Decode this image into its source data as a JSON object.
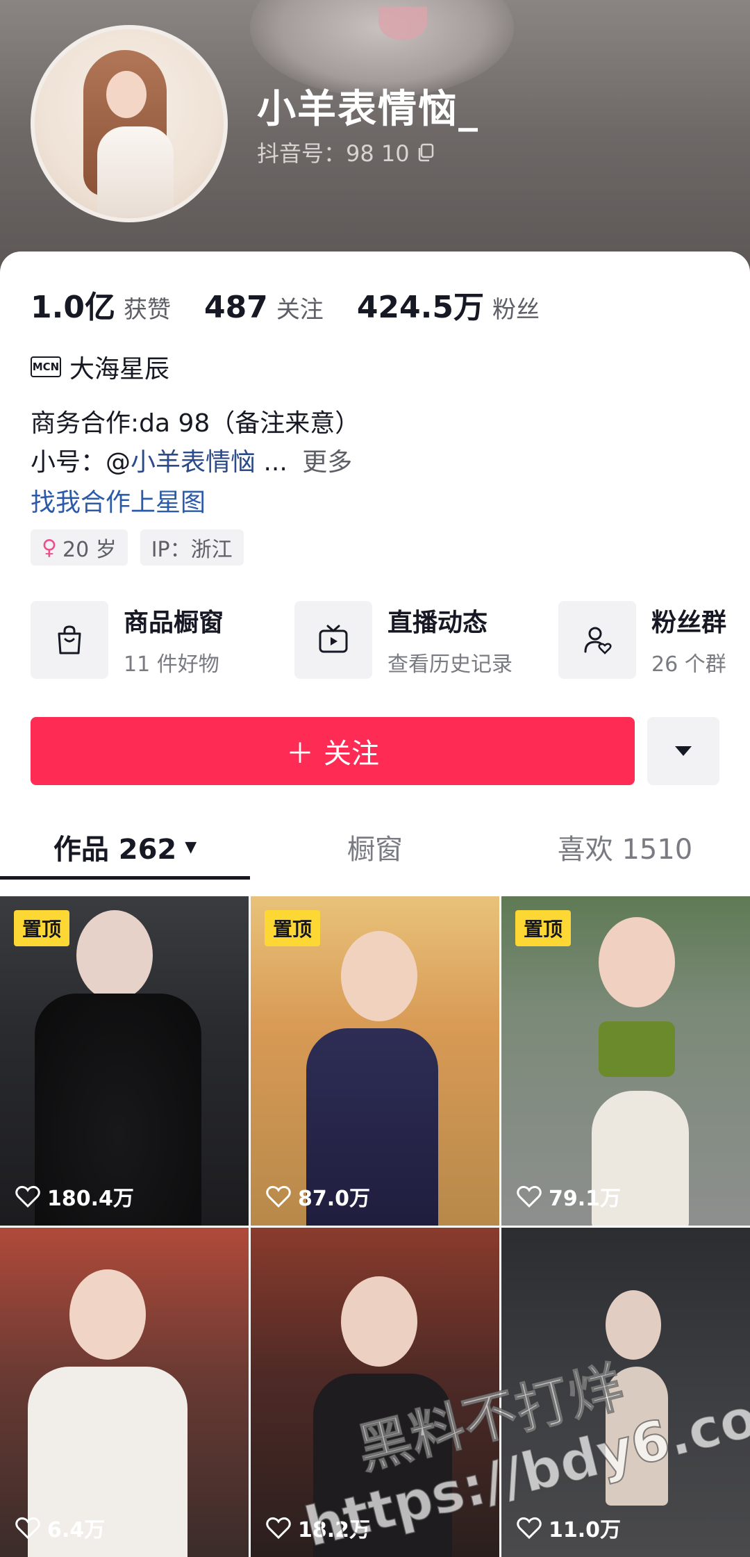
{
  "profile": {
    "username": "小羊表情恼_",
    "douyin_id": "抖音号：98   10"
  },
  "stats": [
    {
      "value": "1.0亿",
      "label": "获赞"
    },
    {
      "value": "487",
      "label": "关注"
    },
    {
      "value": "424.5万",
      "label": "粉丝"
    }
  ],
  "mcn": {
    "badge": "MCN",
    "name": "大海星辰"
  },
  "bio": {
    "line1": "商务合作:da            98（备注来意）",
    "line2_prefix": "小号：@",
    "line2_handle": "小羊表情恼",
    "line2_ellipsis": "...",
    "line2_more": "更多",
    "line3": "找我合作上星图"
  },
  "tags": {
    "age": "20 岁",
    "ip": "IP：浙江"
  },
  "features": [
    {
      "title": "商品橱窗",
      "sub": "11 件好物",
      "icon": "shopping-bag-icon"
    },
    {
      "title": "直播动态",
      "sub": "查看历史记录",
      "icon": "tv-icon"
    },
    {
      "title": "粉丝群",
      "sub": "26 个群",
      "icon": "fan-group-icon"
    }
  ],
  "follow": {
    "label": "关注",
    "plus": "＋"
  },
  "tabs": [
    {
      "label": "作品 262"
    },
    {
      "label": "橱窗"
    },
    {
      "label": "喜欢 1510"
    }
  ],
  "videos": [
    {
      "likes": "180.4万",
      "pinned": "置顶"
    },
    {
      "likes": "87.0万",
      "pinned": "置顶"
    },
    {
      "likes": "79.1万",
      "pinned": "置顶"
    },
    {
      "likes": "6.4万"
    },
    {
      "likes": "18.2万"
    },
    {
      "likes": "11.0万"
    }
  ],
  "watermark": {
    "line1": "黑料不打烊",
    "line2": "https://bdy6.co"
  },
  "colors": {
    "accent": "#fe2c55",
    "pin": "#fdd835",
    "link": "#2b5aa8"
  }
}
